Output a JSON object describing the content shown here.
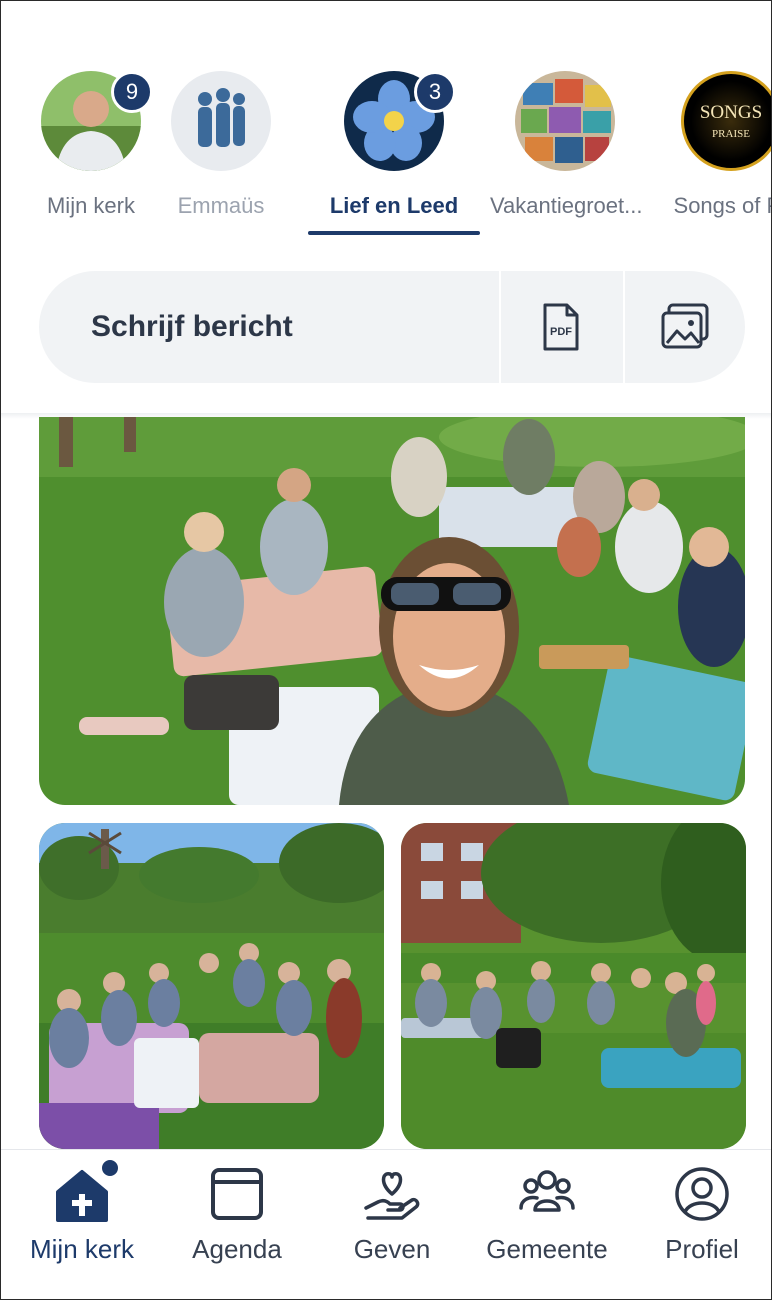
{
  "stories": [
    {
      "label": "Mijn kerk",
      "badge": "9"
    },
    {
      "label": "Emmaüs",
      "badge": ""
    },
    {
      "label": "Lief en Leed",
      "badge": "3"
    },
    {
      "label": "Vakantiegroet...",
      "badge": ""
    },
    {
      "label": "Songs of Pr",
      "badge": ""
    }
  ],
  "songs_logo": {
    "line1": "SONGS",
    "line2": "PRAISE"
  },
  "compose": {
    "placeholder": "Schrijf bericht",
    "pdf_label": "PDF"
  },
  "nav": [
    {
      "label": "Mijn kerk"
    },
    {
      "label": "Agenda"
    },
    {
      "label": "Geven"
    },
    {
      "label": "Gemeente"
    },
    {
      "label": "Profiel"
    }
  ],
  "colors": {
    "accent": "#1d3a6a",
    "grass": "#4f8f2e",
    "compose_bg": "#f1f3f5"
  },
  "photos": [
    "picnic-selfie-photo",
    "picnic-field-photo",
    "picnic-garden-photo"
  ]
}
